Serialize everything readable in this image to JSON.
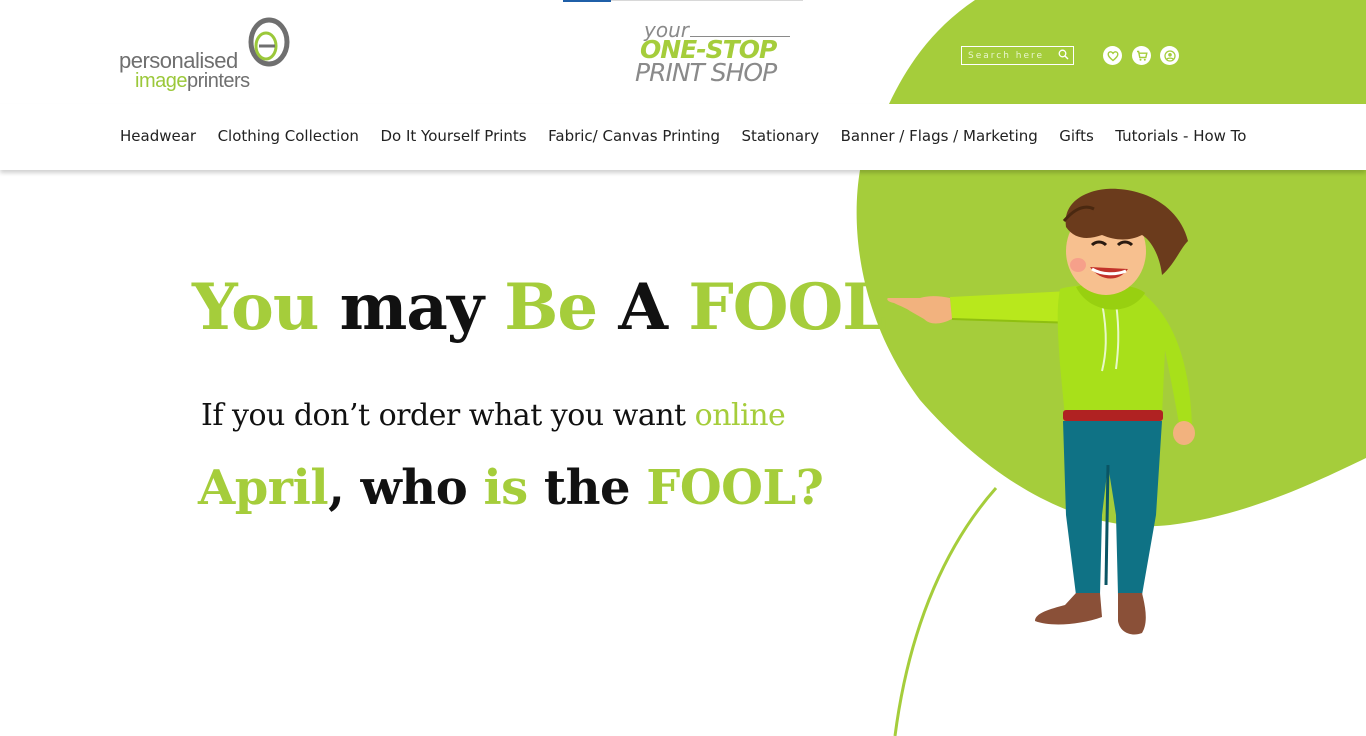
{
  "header": {
    "logo": {
      "line1": "personalised",
      "line2_image": "image",
      "line2_printers": "printers"
    },
    "tagline": {
      "your": "your",
      "one_stop": "ONE-STOP",
      "print_shop": "PRINT SHOP"
    },
    "search": {
      "placeholder": "Search here"
    },
    "icons": [
      "heart-icon",
      "cart-icon",
      "user-icon"
    ]
  },
  "nav": {
    "items": [
      "Headwear",
      "Clothing Collection",
      "Do It Yourself Prints",
      "Fabric/ Canvas Printing",
      "Stationary",
      "Banner / Flags / Marketing",
      "Gifts",
      "Tutorials - How To"
    ]
  },
  "hero": {
    "headline": {
      "w1": "You",
      "w2": "may",
      "w3": "Be",
      "w4": "A",
      "w5": "FOOL"
    },
    "line2": {
      "text": "If you don’t order what you want",
      "accent": "online"
    },
    "line3": {
      "w1": "April",
      "w2": ", who",
      "w3": "is",
      "w4": "the",
      "w5": "FOOL?"
    }
  },
  "colors": {
    "accent": "#a5cd3b",
    "text": "#111111",
    "nav_text": "#222222"
  }
}
